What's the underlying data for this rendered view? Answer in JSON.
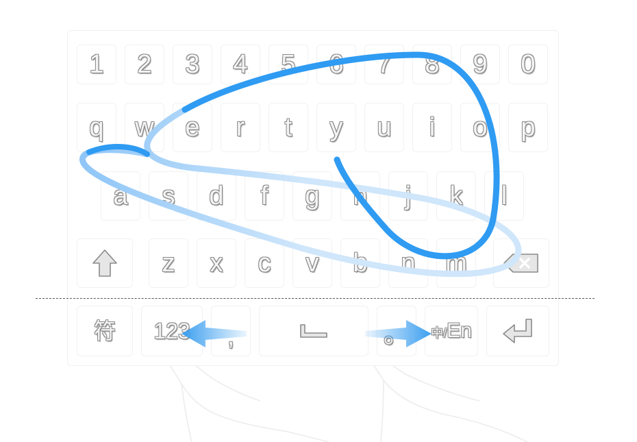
{
  "keyboard": {
    "rows": [
      [
        "1",
        "2",
        "3",
        "4",
        "5",
        "6",
        "7",
        "8",
        "9",
        "0"
      ],
      [
        "q",
        "w",
        "e",
        "r",
        "t",
        "y",
        "u",
        "i",
        "o",
        "p"
      ],
      [
        "a",
        "s",
        "d",
        "f",
        "g",
        "h",
        "j",
        "k",
        "l"
      ],
      [
        "z",
        "x",
        "c",
        "v",
        "b",
        "n",
        "m"
      ]
    ],
    "bottom": {
      "symbols": "符",
      "numbers": "123",
      "comma": ",",
      "period": "。",
      "lang_zh": "中",
      "lang_sep": "/",
      "lang_en": "En"
    }
  },
  "colors": {
    "trail": "#2f9bf2",
    "trail_light": "#b9ddfb",
    "arrow": "#3c9ff0",
    "key_border": "#f1f1f1",
    "divider": "#555555"
  },
  "icons": {
    "shift": "shift-icon",
    "backspace": "backspace-icon",
    "space": "space-icon",
    "enter": "enter-icon",
    "arrow_left": "arrow-left-icon",
    "arrow_right": "arrow-right-icon",
    "hands": "hand-outline-icon"
  }
}
